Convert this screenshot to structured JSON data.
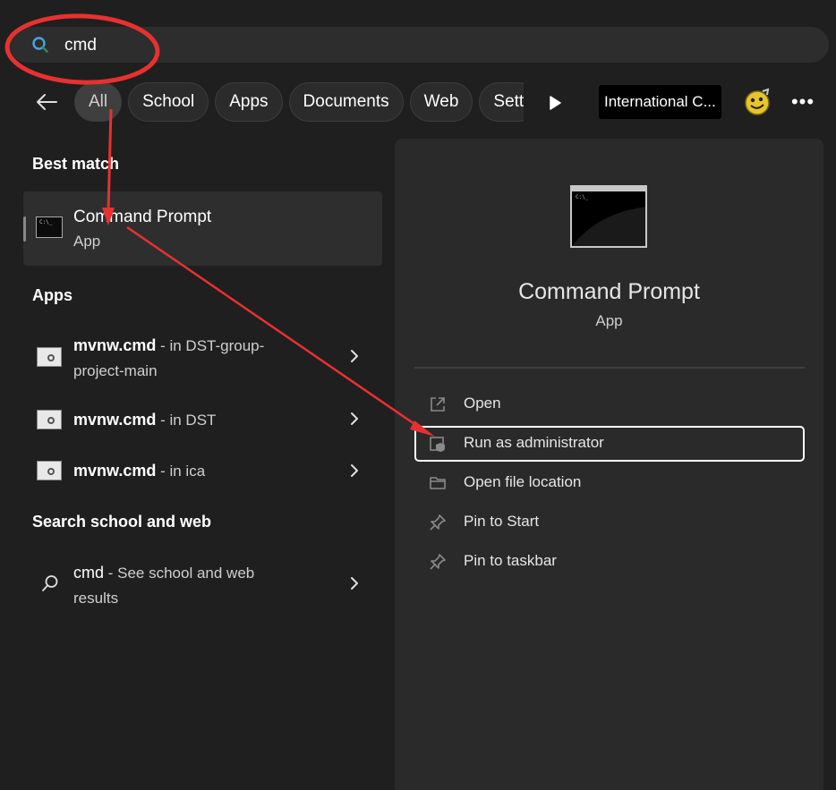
{
  "search": {
    "value": "cmd"
  },
  "filters": [
    "All",
    "School",
    "Apps",
    "Documents",
    "Web",
    "Sett"
  ],
  "search_highlight_label": "International C...",
  "left": {
    "best_match_heading": "Best match",
    "best_match": {
      "title": "Command Prompt",
      "type": "App"
    },
    "apps_heading": "Apps",
    "apps": [
      {
        "name": "mvnw.cmd",
        "location_line1": " - in DST-group-",
        "location_line2": "project-main"
      },
      {
        "name": "mvnw.cmd",
        "location_line1": " - in DST"
      },
      {
        "name": "mvnw.cmd",
        "location_line1": " - in ica"
      }
    ],
    "web_heading": "Search school and web",
    "web_result": {
      "query": "cmd",
      "suffix": " - See school and web",
      "line2": "results"
    }
  },
  "detail": {
    "title": "Command Prompt",
    "type": "App",
    "actions": [
      "Open",
      "Run as administrator",
      "Open file location",
      "Pin to Start",
      "Pin to taskbar"
    ]
  },
  "icon_text": "C:\\_"
}
